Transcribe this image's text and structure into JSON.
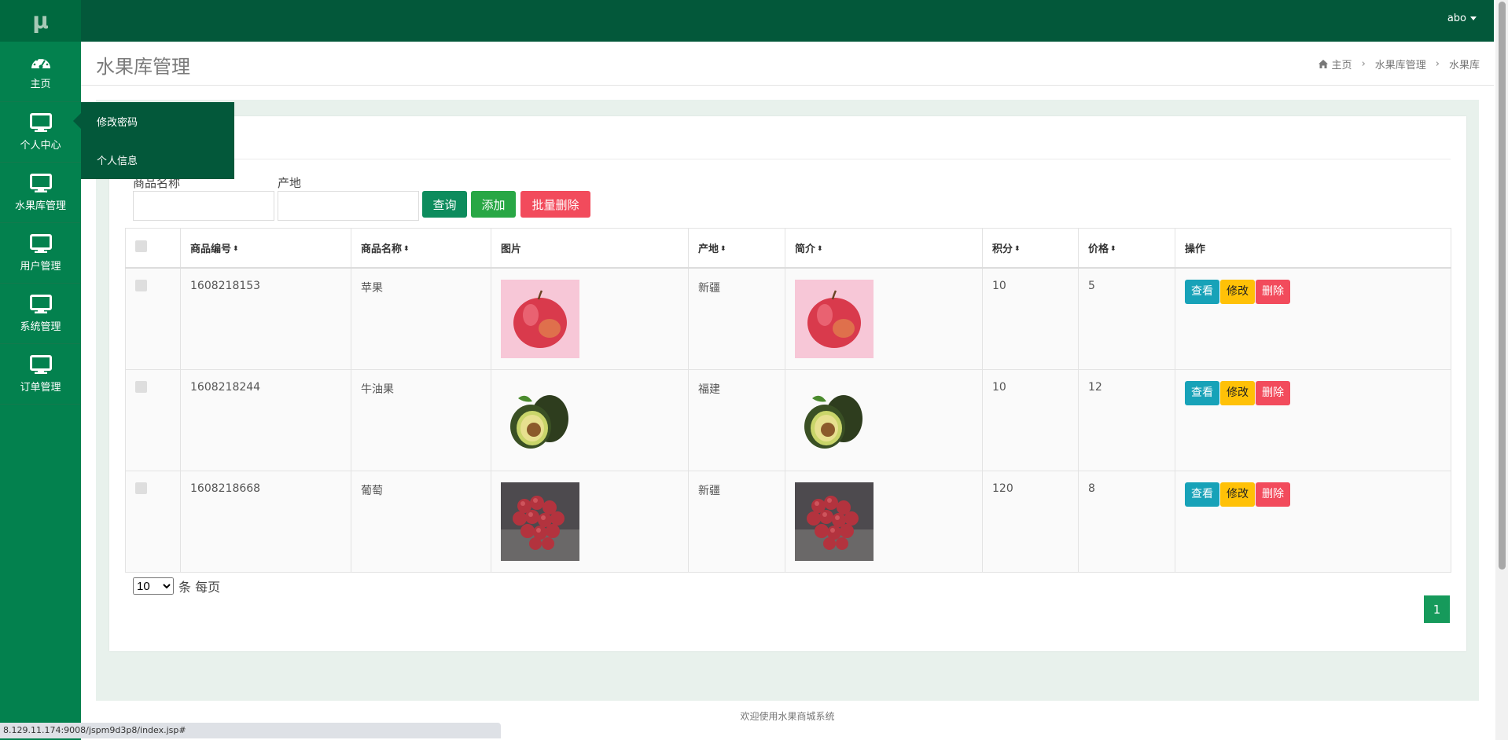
{
  "sidebar": {
    "logo": "μ",
    "items": [
      {
        "label": "主页",
        "icon": "dashboard-icon"
      },
      {
        "label": "个人中心",
        "icon": "monitor-icon"
      },
      {
        "label": "水果库管理",
        "icon": "monitor-icon"
      },
      {
        "label": "用户管理",
        "icon": "monitor-icon"
      },
      {
        "label": "系统管理",
        "icon": "monitor-icon"
      },
      {
        "label": "订单管理",
        "icon": "monitor-icon"
      }
    ]
  },
  "topbar": {
    "user": "abo"
  },
  "header": {
    "title": "水果库管理",
    "breadcrumb": [
      "主页",
      "水果库管理",
      "水果库"
    ]
  },
  "popover": {
    "items": [
      "修改密码",
      "个人信息"
    ]
  },
  "search": {
    "name_label": "商品名称",
    "origin_label": "产地",
    "query_button": "查询",
    "add_button": "添加",
    "batch_delete_button": "批量删除"
  },
  "table": {
    "headers": [
      "商品编号",
      "商品名称",
      "图片",
      "产地",
      "简介",
      "积分",
      "价格",
      "操作"
    ],
    "rows": [
      {
        "id": "1608218153",
        "name": "苹果",
        "image": "apple",
        "origin": "新疆",
        "intro_image": "apple",
        "points": "10",
        "price": "5"
      },
      {
        "id": "1608218244",
        "name": "牛油果",
        "image": "avocado",
        "origin": "福建",
        "intro_image": "avocado",
        "points": "10",
        "price": "12"
      },
      {
        "id": "1608218668",
        "name": "葡萄",
        "image": "grape",
        "origin": "新疆",
        "intro_image": "grape",
        "points": "120",
        "price": "8"
      }
    ],
    "actions": {
      "view": "查看",
      "edit": "修改",
      "delete": "删除"
    }
  },
  "pagination": {
    "page_size": "10",
    "page_size_suffix": "条 每页",
    "current_page": "1"
  },
  "footer": {
    "text": "欢迎使用水果商城系统"
  },
  "statusbar": {
    "url": "8.129.11.174:9008/jspm9d3p8/index.jsp#"
  },
  "colors": {
    "sidebar": "#03814e",
    "topbar": "#03583a",
    "query": "#0d8c5d",
    "add": "#28a745",
    "batch_delete": "#f24b5c",
    "view": "#17a2b8",
    "edit": "#ffc107",
    "delete": "#f24b5c"
  }
}
